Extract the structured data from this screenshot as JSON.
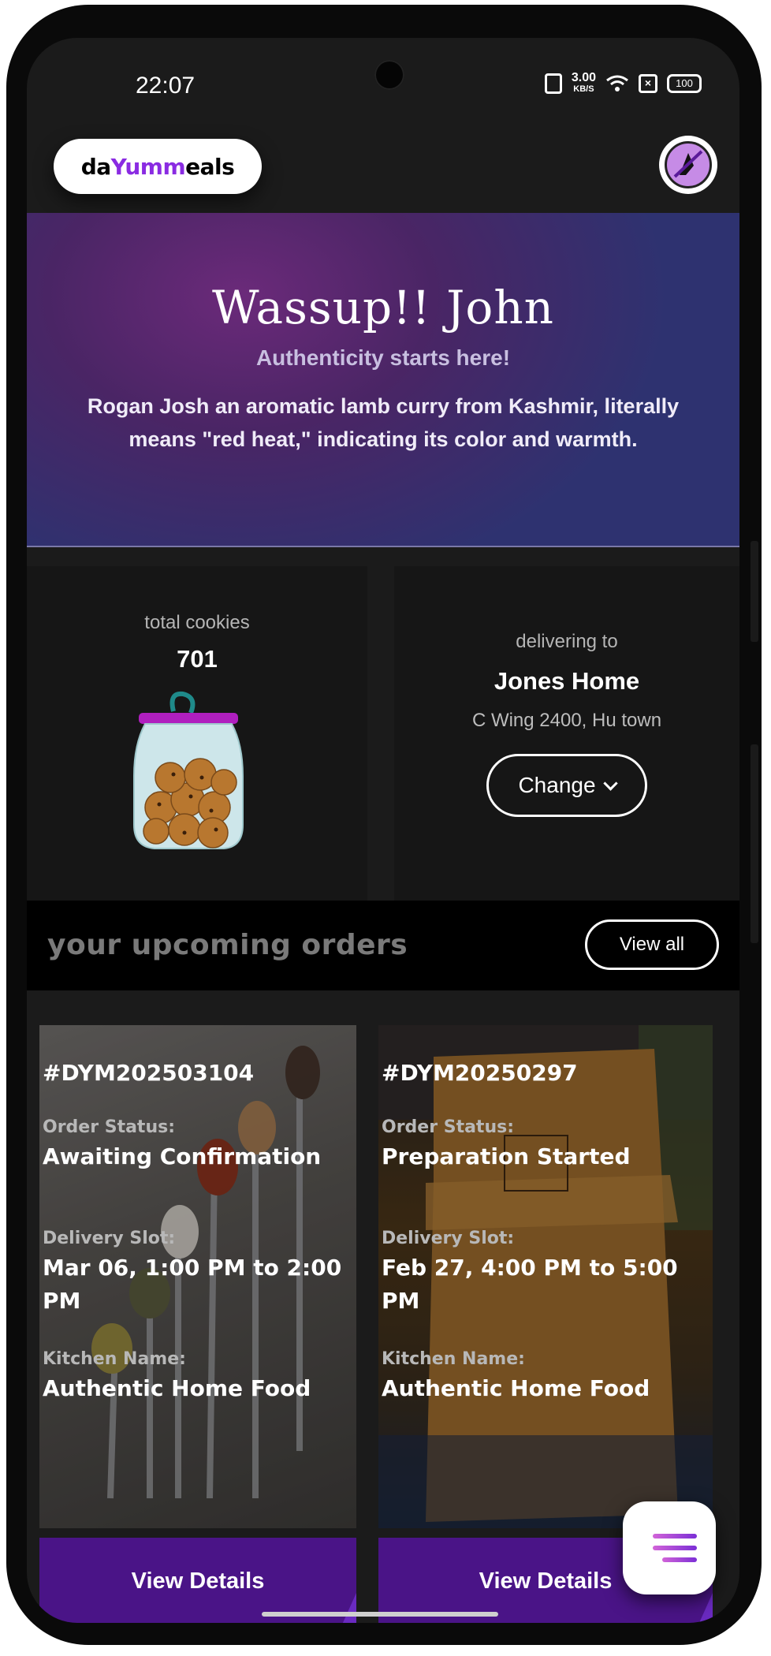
{
  "status_bar": {
    "time": "22:07",
    "speed_value": "3.00",
    "speed_unit": "KB/S",
    "battery": "100"
  },
  "header": {
    "logo_part1": "da",
    "logo_part2": "Yumm",
    "logo_part3": "eals"
  },
  "hero": {
    "greeting": "Wassup!! John",
    "tagline": "Authenticity starts here!",
    "description": "Rogan Josh an aromatic lamb curry from Kashmir, literally means \"red heat,\" indicating its color and warmth."
  },
  "cookies": {
    "label": "total cookies",
    "count": "701"
  },
  "delivery": {
    "label": "delivering to",
    "name": "Jones Home",
    "address": "C Wing 2400, Hu town",
    "change_label": "Change"
  },
  "orders_section": {
    "title": "your upcoming orders",
    "view_all_label": "View all"
  },
  "orders": [
    {
      "id": "#DYM202503104",
      "status_label": "Order Status:",
      "status": "Awaiting Confirmation",
      "slot_label": "Delivery Slot:",
      "slot": "Mar 06, 1:00 PM to 2:00 PM",
      "kitchen_label": "Kitchen Name:",
      "kitchen": "Authentic Home Food",
      "button": "View Details"
    },
    {
      "id": "#DYM20250297",
      "status_label": "Order Status:",
      "status": "Preparation Started",
      "slot_label": "Delivery Slot:",
      "slot": "Feb 27, 4:00 PM to 5:00 PM",
      "kitchen_label": "Kitchen Name:",
      "kitchen": "Authentic Home Food",
      "button": "View Details"
    }
  ],
  "colors": {
    "brand_purple": "#8a2be2",
    "card_footer": "#4a1487",
    "hero_start": "#6b2a7a",
    "hero_end": "#2e3270"
  },
  "icons": {
    "menu_fab": "hamburger-menu-icon",
    "avatar": "profile-avatar-icon",
    "cookie_jar": "cookie-jar-icon"
  }
}
